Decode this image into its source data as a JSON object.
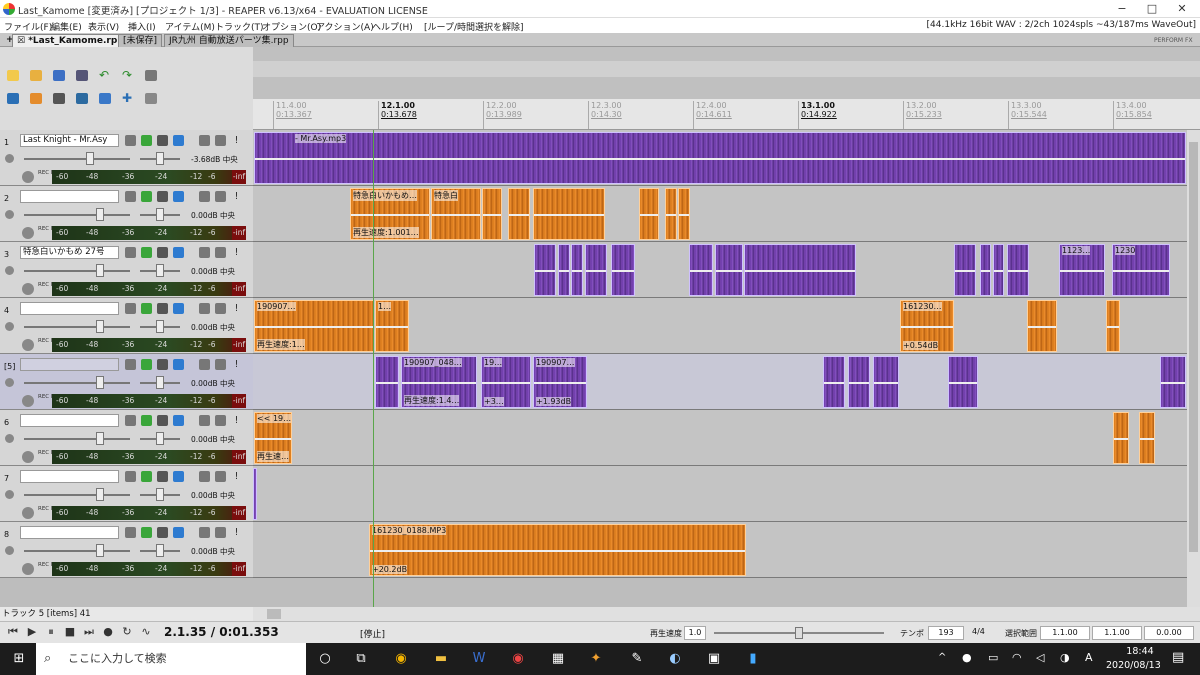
{
  "window": {
    "title": "Last_Kamome [変更済み] [プロジェクト 1/3] - REAPER v6.13/x64 - EVALUATION LICENSE",
    "minimize": "−",
    "maximize": "□",
    "close": "✕"
  },
  "menu": {
    "items": [
      "ファイル(F)",
      "編集(E)",
      "表示(V)",
      "挿入(I)",
      "アイテム(M)",
      "トラック(T)",
      "オプション(O)",
      "アクション(A)",
      "ヘルプ(H)",
      "[ループ/時間選択を解除]"
    ],
    "status": "[44.1kHz 16bit WAV : 2/2ch 1024spls ~43/187ms WaveOut]"
  },
  "tabs": {
    "add": "+",
    "items": [
      {
        "label": "☒ *Last_Kamome.rpp"
      },
      {
        "label": "[未保存]"
      },
      {
        "label": "JR九州 自動放送パーツ集.rpp"
      }
    ],
    "mode": "PERFORM FX"
  },
  "tracks": [
    {
      "num": "1",
      "name": "Last Knight - Mr.Asy",
      "vol": "-3.68dB 中央"
    },
    {
      "num": "2",
      "name": "",
      "vol": "0.00dB 中央"
    },
    {
      "num": "3",
      "name": "特急白いかもめ 27号",
      "vol": "0.00dB 中央"
    },
    {
      "num": "4",
      "name": "",
      "vol": "0.00dB 中央"
    },
    {
      "num": "[5]",
      "name": "",
      "vol": "0.00dB 中央"
    },
    {
      "num": "6",
      "name": "",
      "vol": "0.00dB 中央"
    },
    {
      "num": "7",
      "name": "",
      "vol": "0.00dB 中央"
    },
    {
      "num": "8",
      "name": "",
      "vol": "0.00dB 中央"
    }
  ],
  "meter_scale": [
    "-60",
    "-48",
    "-36",
    "-24",
    "-12",
    "-6",
    "-inf"
  ],
  "rec_in": "REC\nIN",
  "tcp_status": "トラック 5 [items] 41",
  "ruler": [
    {
      "bar": "11.4.00",
      "time": "0:13.367"
    },
    {
      "bar": "12.1.00",
      "time": "0:13.678"
    },
    {
      "bar": "12.2.00",
      "time": "0:13.989"
    },
    {
      "bar": "12.3.00",
      "time": "0:14.30"
    },
    {
      "bar": "12.4.00",
      "time": "0:14.611"
    },
    {
      "bar": "13.1.00",
      "time": "0:14.922"
    },
    {
      "bar": "13.2.00",
      "time": "0:15.233"
    },
    {
      "bar": "13.3.00",
      "time": "0:15.544"
    },
    {
      "bar": "13.4.00",
      "time": "0:15.854"
    }
  ],
  "items": {
    "t1": {
      "top": "- Mr.Asy.mp3",
      "bottom": ""
    },
    "t2a": {
      "top": "特急白いかもめ…",
      "bottom": "再生速度:1.001…"
    },
    "t2b": {
      "top": "特急白",
      "bottom": ""
    },
    "t3a": {
      "top": "1123…",
      "bottom": ""
    },
    "t3b": {
      "top": "1230",
      "bottom": ""
    },
    "t4a": {
      "top": "190907…",
      "bottom": "再生速度:1…"
    },
    "t4b": {
      "top": "1…",
      "bottom": ""
    },
    "t4c": {
      "top": "161230…",
      "bottom": "+0.54dB"
    },
    "t5a": {
      "top": "190907_048…",
      "bottom": "再生速度:1.4…"
    },
    "t5b": {
      "top": "19…",
      "bottom": "+3…"
    },
    "t5c": {
      "top": "190907…",
      "bottom": "+1.93dB"
    },
    "t6": {
      "top": "<< 19…",
      "bottom": "再生速…"
    },
    "t8": {
      "top": "161230_0188.MP3",
      "bottom": "+20.2dB"
    }
  },
  "transport": {
    "position": "2.1.35 / 0:01.353",
    "state": "[停止]",
    "rate_label": "再生速度",
    "rate": "1.0",
    "tempo_label": "テンポ",
    "tempo": "193",
    "sig": "4/4",
    "sel_label": "選択範囲",
    "sel_start": "1.1.00",
    "sel_end": "1.1.00",
    "sel_len": "0.0.00"
  },
  "taskbar": {
    "search": "ここに入力して検索",
    "time": "18:44",
    "date": "2020/08/13",
    "lang": "A"
  }
}
